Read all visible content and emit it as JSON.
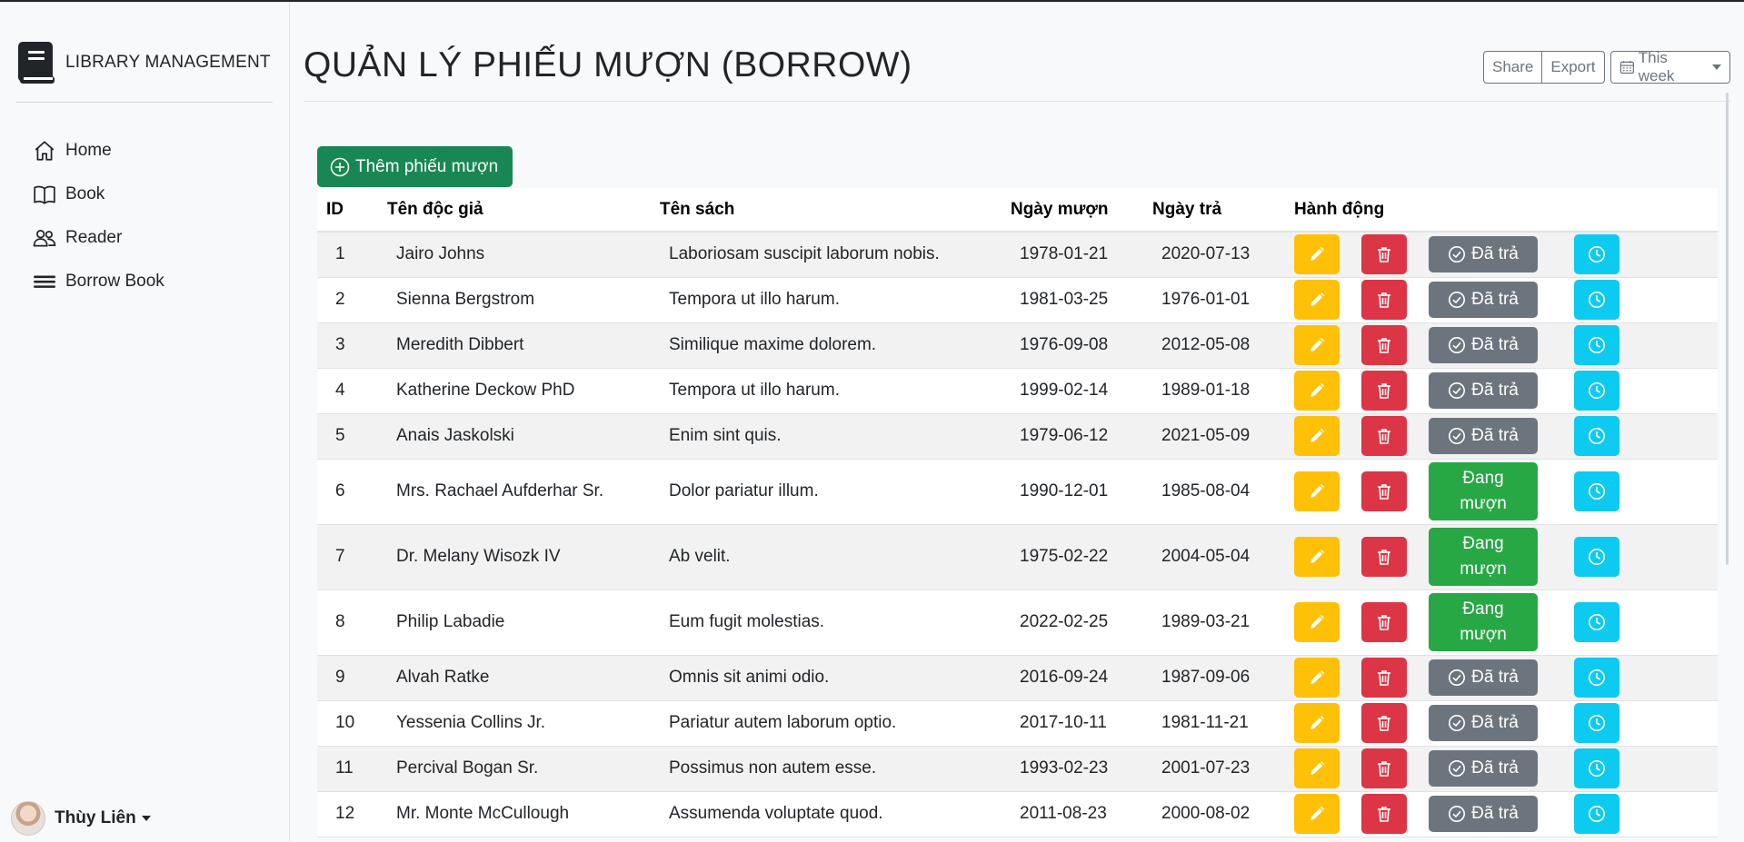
{
  "brand": {
    "title": "LIBRARY MANAGEMENT",
    "icon": "book-icon"
  },
  "nav": [
    {
      "label": "Home",
      "icon": "home-icon"
    },
    {
      "label": "Book",
      "icon": "open-book-icon"
    },
    {
      "label": "Reader",
      "icon": "people-icon"
    },
    {
      "label": "Borrow Book",
      "icon": "list-icon"
    }
  ],
  "user": {
    "name": "Thùy Liên"
  },
  "header": {
    "title": "QUẢN LÝ PHIẾU MƯỢN (BORROW)",
    "share_label": "Share",
    "export_label": "Export",
    "week_label": "This week"
  },
  "add_button": {
    "label": "Thêm phiếu mượn"
  },
  "table": {
    "headers": [
      "ID",
      "Tên độc giả",
      "Tên sách",
      "Ngày mượn",
      "Ngày trả",
      "Hành động"
    ],
    "status_labels": {
      "returned": "Đã trả",
      "borrowing": "Đang mượn"
    },
    "rows": [
      {
        "id": "1",
        "reader": "Jairo Johns",
        "book": "Laboriosam suscipit laborum nobis.",
        "borrow_date": "1978-01-21",
        "return_date": "2020-07-13",
        "status": "returned"
      },
      {
        "id": "2",
        "reader": "Sienna Bergstrom",
        "book": "Tempora ut illo harum.",
        "borrow_date": "1981-03-25",
        "return_date": "1976-01-01",
        "status": "returned"
      },
      {
        "id": "3",
        "reader": "Meredith Dibbert",
        "book": "Similique maxime dolorem.",
        "borrow_date": "1976-09-08",
        "return_date": "2012-05-08",
        "status": "returned"
      },
      {
        "id": "4",
        "reader": "Katherine Deckow PhD",
        "book": "Tempora ut illo harum.",
        "borrow_date": "1999-02-14",
        "return_date": "1989-01-18",
        "status": "returned"
      },
      {
        "id": "5",
        "reader": "Anais Jaskolski",
        "book": "Enim sint quis.",
        "borrow_date": "1979-06-12",
        "return_date": "2021-05-09",
        "status": "returned"
      },
      {
        "id": "6",
        "reader": "Mrs. Rachael Aufderhar Sr.",
        "book": "Dolor pariatur illum.",
        "borrow_date": "1990-12-01",
        "return_date": "1985-08-04",
        "status": "borrowing"
      },
      {
        "id": "7",
        "reader": "Dr. Melany Wisozk IV",
        "book": "Ab velit.",
        "borrow_date": "1975-02-22",
        "return_date": "2004-05-04",
        "status": "borrowing"
      },
      {
        "id": "8",
        "reader": "Philip Labadie",
        "book": "Eum fugit molestias.",
        "borrow_date": "2022-02-25",
        "return_date": "1989-03-21",
        "status": "borrowing"
      },
      {
        "id": "9",
        "reader": "Alvah Ratke",
        "book": "Omnis sit animi odio.",
        "borrow_date": "2016-09-24",
        "return_date": "1987-09-06",
        "status": "returned"
      },
      {
        "id": "10",
        "reader": "Yessenia Collins Jr.",
        "book": "Pariatur autem laborum optio.",
        "borrow_date": "2017-10-11",
        "return_date": "1981-11-21",
        "status": "returned"
      },
      {
        "id": "11",
        "reader": "Percival Bogan Sr.",
        "book": "Possimus non autem esse.",
        "borrow_date": "1993-02-23",
        "return_date": "2001-07-23",
        "status": "returned"
      },
      {
        "id": "12",
        "reader": "Mr. Monte McCullough",
        "book": "Assumenda voluptate quod.",
        "borrow_date": "2011-08-23",
        "return_date": "2000-08-02",
        "status": "returned"
      }
    ]
  },
  "colors": {
    "edit": "#ffc107",
    "delete": "#dc3545",
    "returned": "#6c757d",
    "borrowing": "#28a745",
    "history": "#0dcaf0",
    "add": "#198754"
  }
}
